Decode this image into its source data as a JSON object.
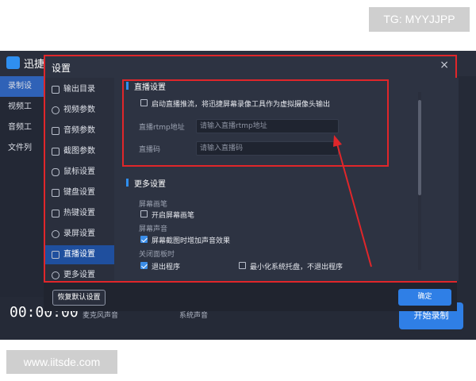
{
  "watermarks": {
    "tg": "TG: MYYJJPP",
    "url": "www.iitsde.com"
  },
  "bg_app": {
    "title": "迅捷",
    "nav": [
      {
        "label": "录制设"
      },
      {
        "label": "视频工"
      },
      {
        "label": "音频工"
      },
      {
        "label": "文件列"
      }
    ],
    "timer": "00:00:00",
    "mic_label": "麦克风声音",
    "system_label": "系统声音",
    "start_label": "开始录制"
  },
  "dialog": {
    "title": "设置",
    "close": "×",
    "sidebar": [
      {
        "label": "输出目录"
      },
      {
        "label": "视频参数"
      },
      {
        "label": "音频参数"
      },
      {
        "label": "截图参数"
      },
      {
        "label": "鼠标设置"
      },
      {
        "label": "键盘设置"
      },
      {
        "label": "热键设置"
      },
      {
        "label": "录屏设置"
      },
      {
        "label": "直播设置"
      },
      {
        "label": "更多设置"
      }
    ],
    "live": {
      "title": "直播设置",
      "enable_label": "启动直播推流，将迅捷屏幕录像工具作为虚拟摄像头输出",
      "rtmp_label": "直播rtmp地址",
      "rtmp_placeholder": "请输入直播rtmp地址",
      "code_label": "直播码",
      "code_placeholder": "请输入直播码"
    },
    "more": {
      "title": "更多设置",
      "pen_heading": "屏幕画笔",
      "pen_option": "开启屏幕画笔",
      "sound_heading": "屏幕声音",
      "sound_option": "屏幕截图时增加声音效果",
      "close_heading": "关闭面板时",
      "exit_option": "退出程序",
      "tray_option": "最小化系统托盘，不退出程序"
    },
    "reset_label": "恢复默认设置",
    "ok_label": "确定"
  }
}
